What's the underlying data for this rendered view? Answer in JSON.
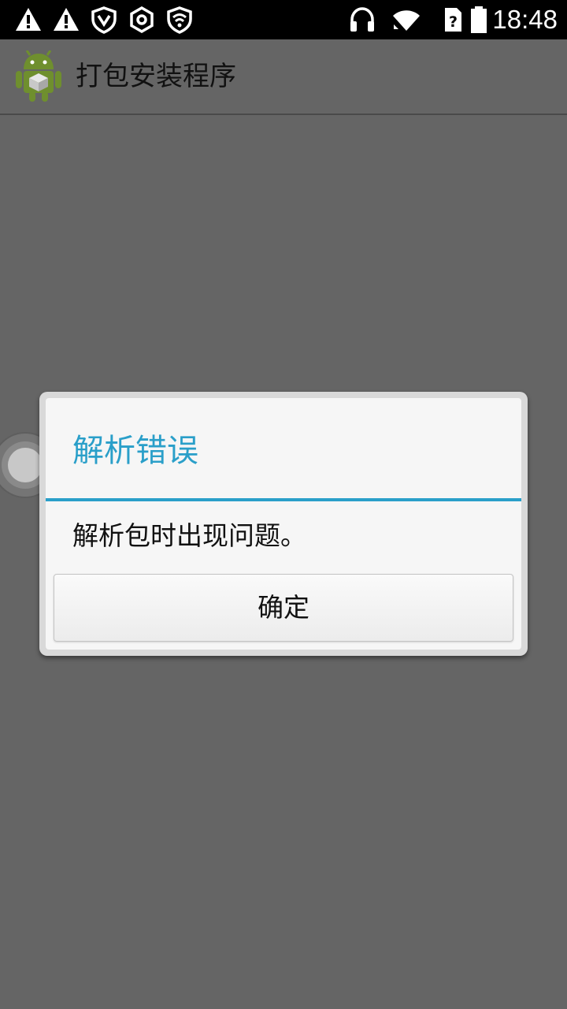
{
  "status_bar": {
    "time": "18:48",
    "icons": [
      "warning-icon",
      "warning-icon",
      "shield-icon",
      "hexagon-icon",
      "shield-wifi-icon",
      "headphones-icon",
      "wifi-icon",
      "sim-unknown-icon",
      "battery-icon"
    ]
  },
  "action_bar": {
    "app_icon": "android-package-icon",
    "title": "打包安装程序"
  },
  "dialog": {
    "title": "解析错误",
    "message": "解析包时出现问题。",
    "ok_button": "确定",
    "accent_color": "#2a9fc9"
  },
  "colors": {
    "background": "#656565",
    "status_bar": "#000000",
    "dialog_background": "#f6f6f6"
  }
}
